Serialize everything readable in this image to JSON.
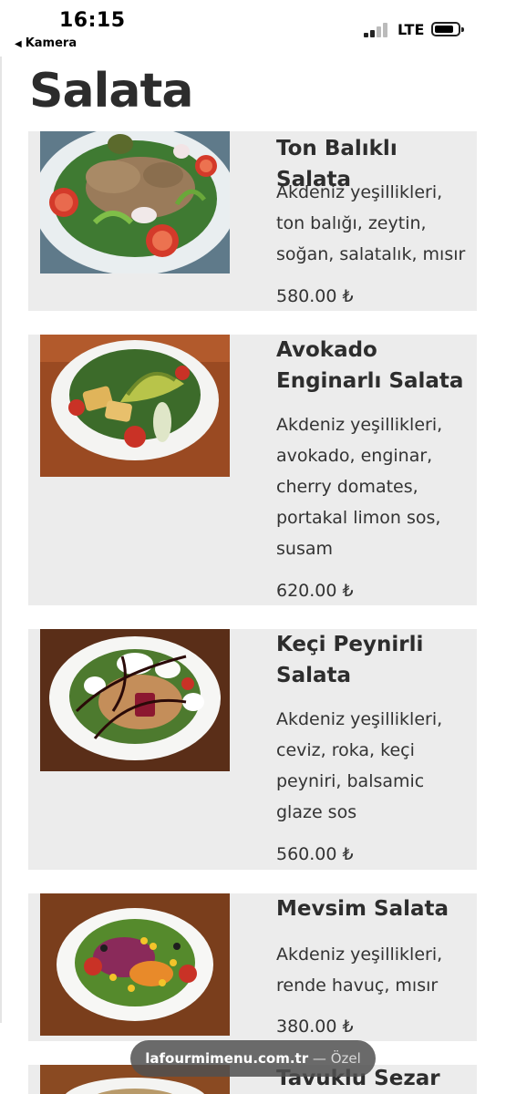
{
  "status_bar": {
    "time": "16:15",
    "back_label": "Kamera",
    "network": "LTE",
    "icons": [
      "back-arrow-icon",
      "signal-icon",
      "battery-icon"
    ]
  },
  "page": {
    "title": "Salata"
  },
  "items": [
    {
      "name": "Ton Balıklı Salata",
      "description": "Akdeniz yeşillikleri, ton balığı, zeytin, soğan, salatalık, mısır",
      "price": "580.00 ₺",
      "image": "tuna-salad-photo"
    },
    {
      "name": "Avokado Enginarlı Salata",
      "description": "Akdeniz yeşillikleri, avokado, enginar, cherry domates, portakal limon sos, susam",
      "price": "620.00 ₺",
      "image": "avocado-artichoke-salad-photo"
    },
    {
      "name": "Keçi Peynirli Salata",
      "description": "Akdeniz yeşillikleri, ceviz, roka, keçi peyniri, balsamic glaze sos",
      "price": "560.00 ₺",
      "image": "goat-cheese-salad-photo"
    },
    {
      "name": "Mevsim Salata",
      "description": "Akdeniz yeşillikleri, rende havuç, mısır",
      "price": "380.00 ₺",
      "image": "seasonal-salad-photo"
    },
    {
      "name": "Tavuklu Sezar",
      "description": "",
      "price": "",
      "image": "chicken-caesar-salad-photo"
    }
  ],
  "browser": {
    "host": "lafourmimenu.com.tr",
    "separator": " — ",
    "mode": "Özel"
  },
  "colors": {
    "card_background": "#ececec",
    "title_text": "#2c2c2c",
    "pill_background": "#505050"
  }
}
